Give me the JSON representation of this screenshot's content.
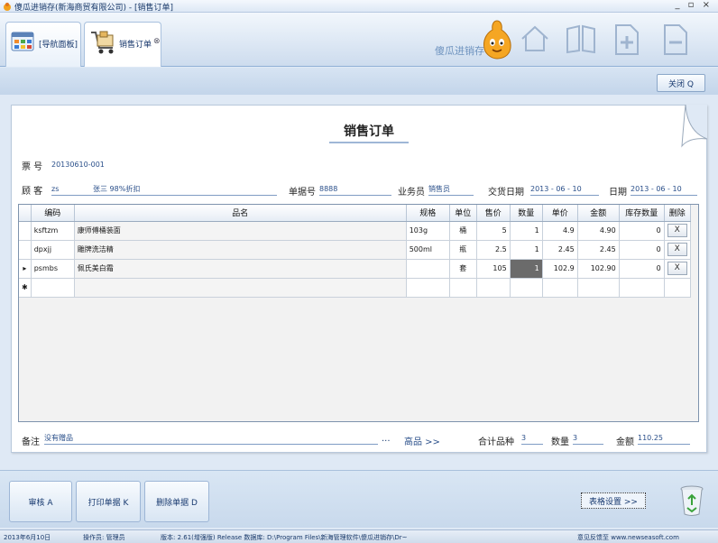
{
  "window": {
    "title": "傻瓜进销存(新海商贸有限公司) - [销售订单]",
    "controls": "_ ▫ ×"
  },
  "tabs": [
    {
      "label": "[导航面板]"
    },
    {
      "label": "销售订单",
      "close": "⊗"
    }
  ],
  "brand": {
    "text": "傻瓜进销存"
  },
  "toolbar": {
    "close_label": "关闭 Q"
  },
  "form": {
    "title": "销售订单",
    "ticket_label": "票  号",
    "ticket_no": "20130610-001",
    "customer_label": "顾 客",
    "customer_code": "zs",
    "customer_name": "张三 98%折扣",
    "docno_label": "单据号",
    "docno": "8888",
    "salesman_label": "业务员",
    "salesman": "销售员",
    "delivery_label": "交货日期",
    "delivery_date": "2013 - 06 - 10",
    "date_label": "日期",
    "date": "2013 - 06 - 10"
  },
  "grid": {
    "columns": [
      "编码",
      "品名",
      "规格",
      "单位",
      "售价",
      "数量",
      "单价",
      "金额",
      "库存数量",
      "删除"
    ],
    "rows": [
      {
        "marker": "",
        "code": "ksftzm",
        "name": "康师傅桶装面",
        "spec": "103g",
        "unit": "桶",
        "price": "5",
        "qty": "1",
        "unit_price": "4.9",
        "amount": "4.90",
        "stock": "0",
        "del": "X"
      },
      {
        "marker": "",
        "code": "dpxjj",
        "name": "雕牌洗洁精",
        "spec": "500ml",
        "unit": "瓶",
        "price": "2.5",
        "qty": "1",
        "unit_price": "2.45",
        "amount": "2.45",
        "stock": "0",
        "del": "X"
      },
      {
        "marker": "▸",
        "code": "psmbs",
        "name": "佩氏美白霜",
        "spec": "",
        "unit": "套",
        "price": "105",
        "qty": "1",
        "unit_price": "102.9",
        "amount": "102.90",
        "stock": "0",
        "del": "X"
      },
      {
        "marker": "✱",
        "code": "",
        "name": "",
        "spec": "",
        "unit": "",
        "price": "",
        "qty": "",
        "unit_price": "",
        "amount": "",
        "stock": "",
        "del": ""
      }
    ]
  },
  "footer_fields": {
    "remark_label": "备注",
    "remark": "没有赠品",
    "ellipsis": "...",
    "advanced": "高品 >>",
    "total_items_label": "合计品种",
    "total_items": "3",
    "qty_label": "数量",
    "qty": "3",
    "amount_label": "金额",
    "amount": "110.25"
  },
  "actions": {
    "audit": "审核 A",
    "print": "打印单据 K",
    "delete": "删除单据 D",
    "table_settings": "表格设置 >>"
  },
  "status": {
    "date": "2013年6月10日",
    "operator": "操作员: 管理员",
    "version": "版本: 2.61(增强版) Release 数据库: D:\\Program Files\\新海管理软件\\傻瓜进销存\\Dr~",
    "feedback": "意见反馈至 www.newseasoft.com"
  },
  "colors": {
    "accent": "#2a4f8a",
    "frame": "#8fb0d6",
    "selected_cell": "#6b6b6b"
  }
}
